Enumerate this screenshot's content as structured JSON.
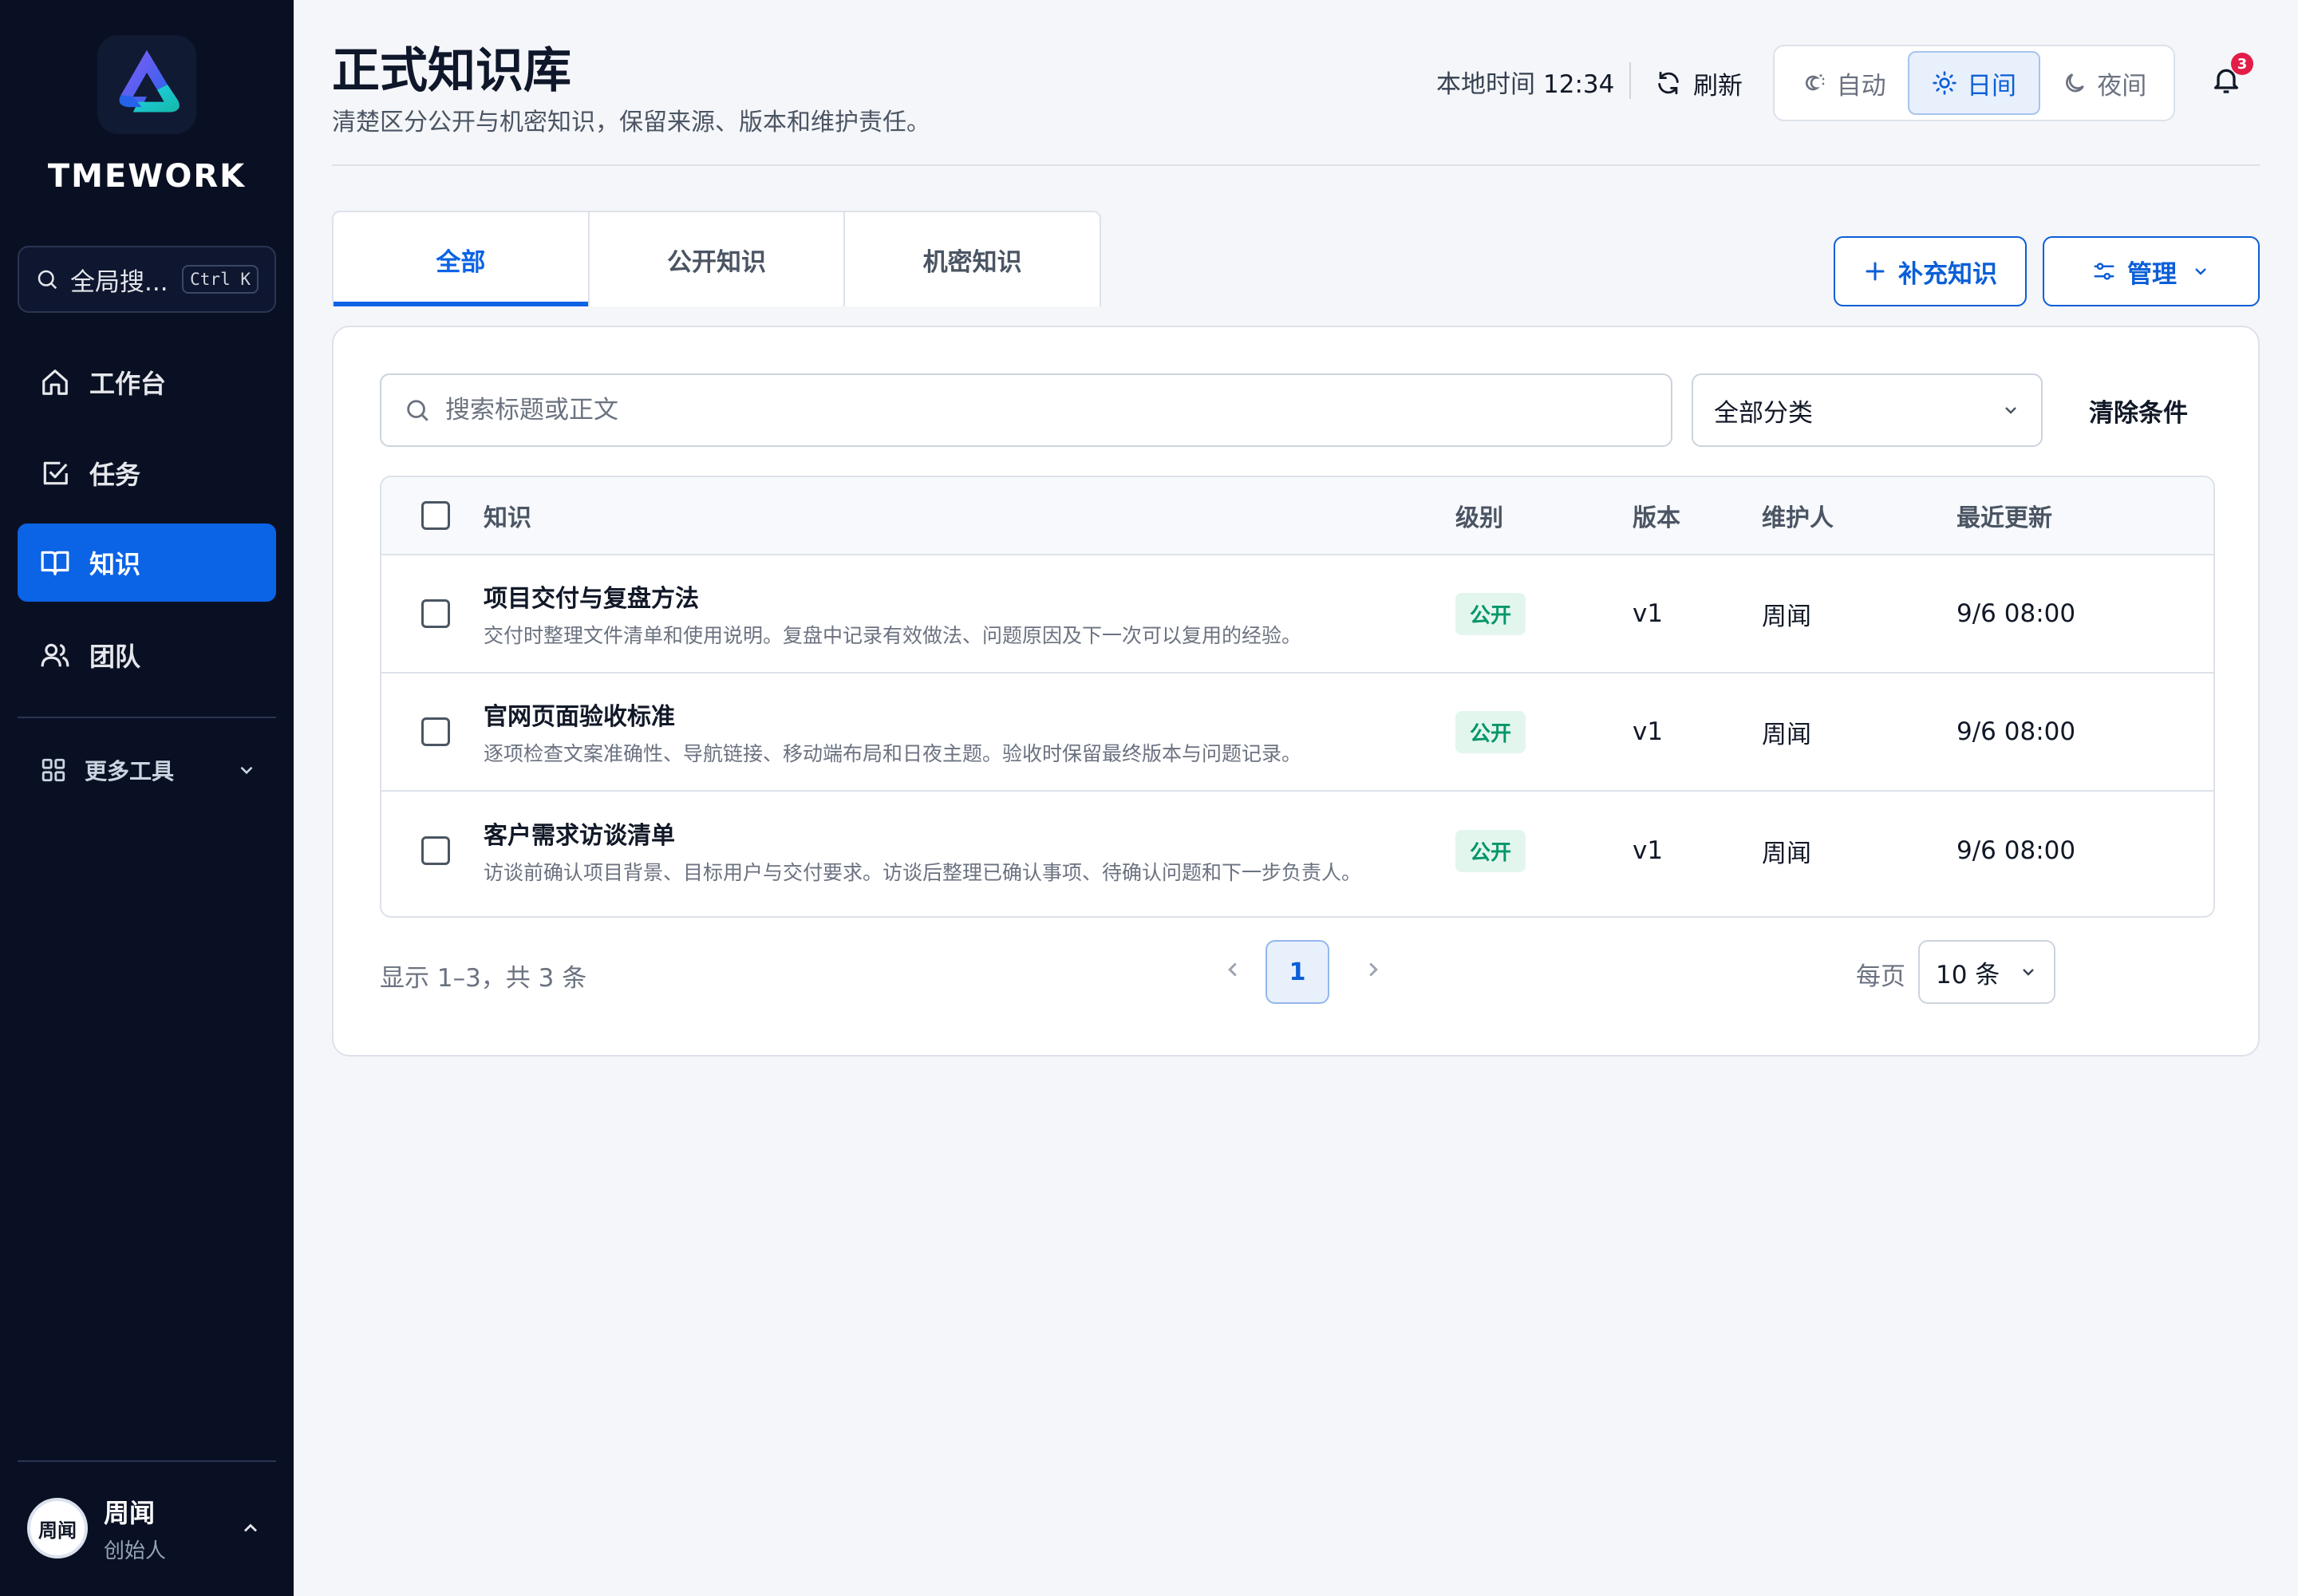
{
  "sidebar": {
    "brand": "TMEWORK",
    "search": {
      "label": "全局搜...",
      "shortcut": "Ctrl K"
    },
    "items": [
      {
        "label": "工作台",
        "icon": "home-icon",
        "active": false
      },
      {
        "label": "任务",
        "icon": "checkbox-icon",
        "active": false
      },
      {
        "label": "知识",
        "icon": "book-icon",
        "active": true
      },
      {
        "label": "团队",
        "icon": "users-icon",
        "active": false
      }
    ],
    "more_tools": "更多工具",
    "user": {
      "avatar_text": "周闻",
      "name": "周闻",
      "role": "创始人"
    }
  },
  "header": {
    "title": "正式知识库",
    "subtitle": "清楚区分公开与机密知识，保留来源、版本和维护责任。",
    "local_time_label": "本地时间",
    "local_time": "12:34",
    "refresh": "刷新",
    "theme": {
      "auto": "自动",
      "day": "日间",
      "night": "夜间",
      "selected": "day"
    },
    "notifications": "3"
  },
  "tabs": [
    {
      "label": "全部",
      "active": true
    },
    {
      "label": "公开知识",
      "active": false
    },
    {
      "label": "机密知识",
      "active": false
    }
  ],
  "actions": {
    "add": "补充知识",
    "manage": "管理"
  },
  "filters": {
    "search_placeholder": "搜索标题或正文",
    "category": "全部分类",
    "clear": "清除条件"
  },
  "table": {
    "columns": {
      "knowledge": "知识",
      "level": "级别",
      "version": "版本",
      "maintainer": "维护人",
      "updated": "最近更新"
    },
    "rows": [
      {
        "title": "项目交付与复盘方法",
        "desc": "交付时整理文件清单和使用说明。复盘中记录有效做法、问题原因及下一次可以复用的经验。",
        "level": "公开",
        "version": "v1",
        "maintainer": "周闻",
        "updated": "9/6 08:00"
      },
      {
        "title": "官网页面验收标准",
        "desc": "逐项检查文案准确性、导航链接、移动端布局和日夜主题。验收时保留最终版本与问题记录。",
        "level": "公开",
        "version": "v1",
        "maintainer": "周闻",
        "updated": "9/6 08:00"
      },
      {
        "title": "客户需求访谈清单",
        "desc": "访谈前确认项目背景、目标用户与交付要求。访谈后整理已确认事项、待确认问题和下一步负责人。",
        "level": "公开",
        "version": "v1",
        "maintainer": "周闻",
        "updated": "9/6 08:00"
      }
    ]
  },
  "pagination": {
    "summary": "显示 1–3，共 3 条",
    "current_page": "1",
    "per_page_label": "每页",
    "per_page": "10 条"
  },
  "colors": {
    "accent": "#0b63e5",
    "sidebar_bg": "#0a1023",
    "public_badge": "#059669",
    "badge_alert": "#e11d48"
  }
}
